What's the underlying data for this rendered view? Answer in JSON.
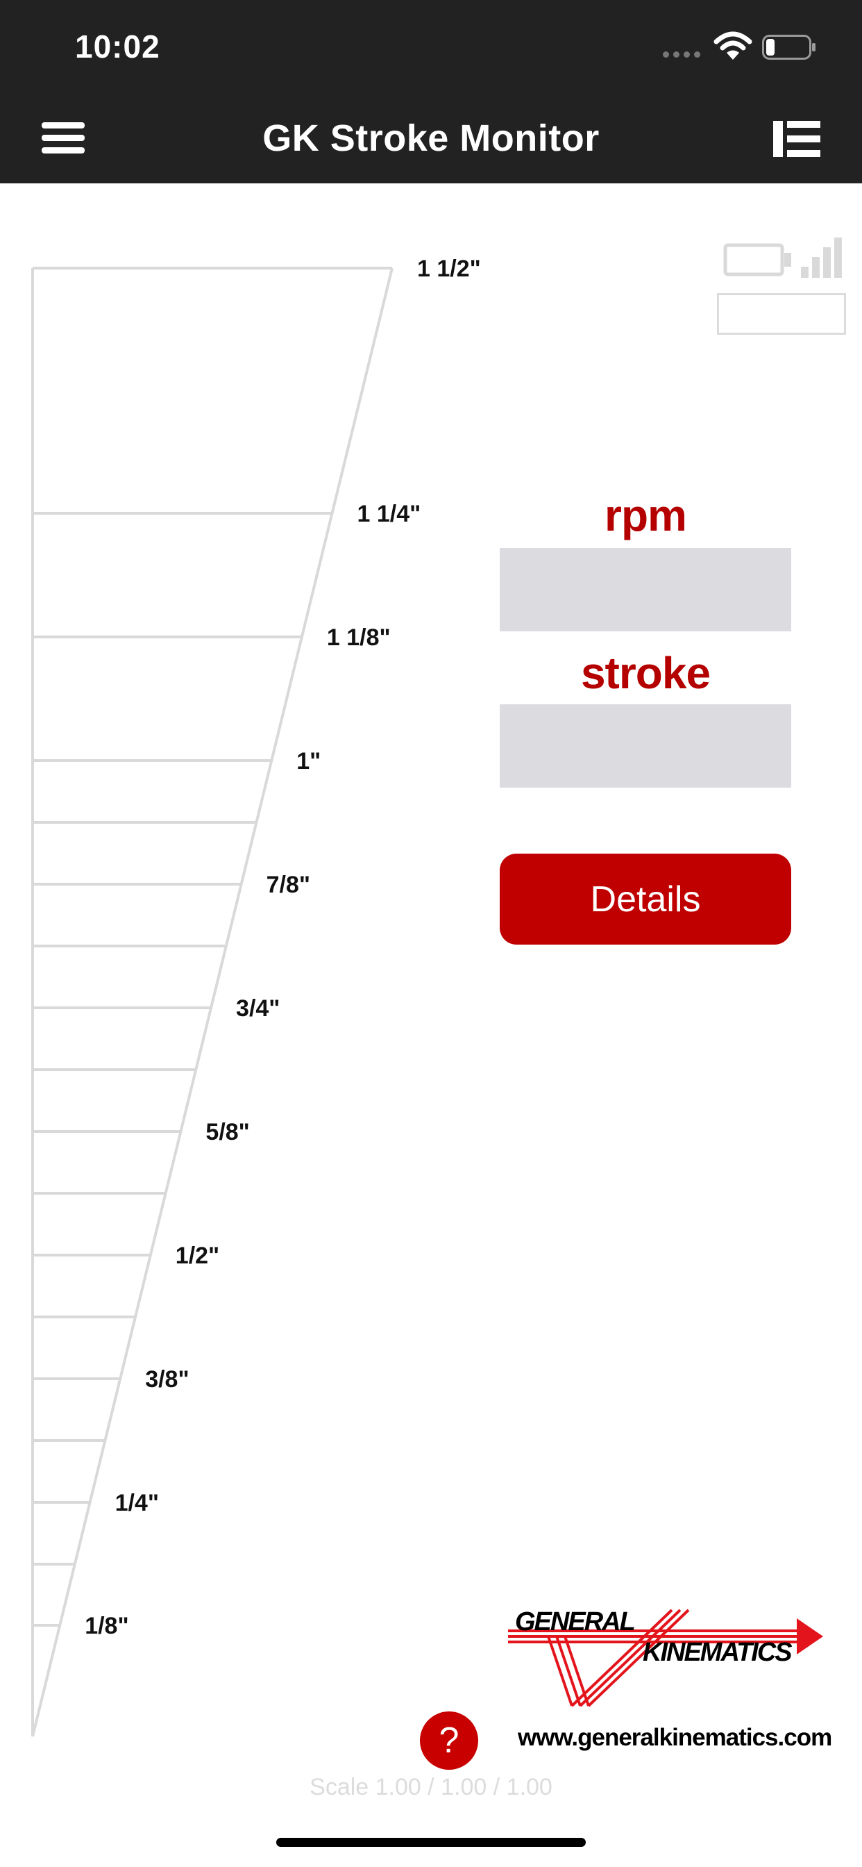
{
  "status_bar": {
    "time": "10:02",
    "icons": [
      "cellular-dots-icon",
      "wifi-icon",
      "battery-icon"
    ],
    "battery_level": 0.2
  },
  "nav": {
    "title": "GK Stroke Monitor",
    "left_icon": "hamburger-menu-icon",
    "right_icon": "list-icon"
  },
  "gauge": {
    "labels": [
      "1 1/2\"",
      "1 1/4\"",
      "1 1/8\"",
      "1\"",
      "7/8\"",
      "3/4\"",
      "5/8\"",
      "1/2\"",
      "3/8\"",
      "1/4\"",
      "1/8\""
    ]
  },
  "device": {
    "icons": [
      "device-battery-icon",
      "signal-strength-icon"
    ],
    "signal_bars_active": 0
  },
  "readouts": {
    "rpm_label": "rpm",
    "rpm_value": "",
    "stroke_label": "stroke",
    "stroke_value": ""
  },
  "actions": {
    "details_label": "Details",
    "help_label": "?"
  },
  "brand": {
    "logo_line1": "GENERAL",
    "logo_line2": "KINEMATICS",
    "website": "www.generalkinematics.com"
  },
  "footer": {
    "scale": "Scale 1.00 / 1.00 / 1.00"
  },
  "colors": {
    "header_bg": "#222222",
    "accent_red": "#c00000",
    "field_bg": "#dcdbdf",
    "gauge_line": "#d9d9d9"
  }
}
